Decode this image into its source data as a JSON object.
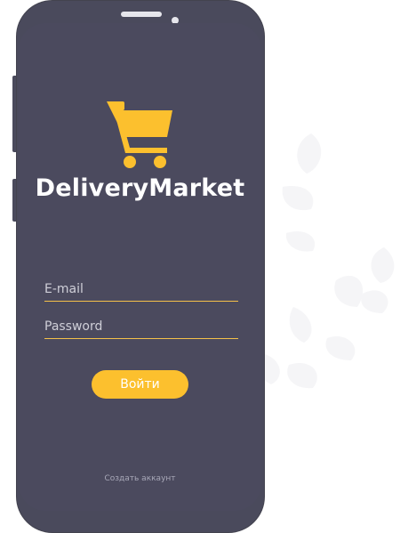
{
  "app": {
    "brand_name": "DeliveryMarket",
    "logo_icon": "shopping-cart-icon"
  },
  "login": {
    "email_placeholder": "E-mail",
    "password_placeholder": "Password",
    "email_value": "",
    "password_value": "",
    "submit_label": "Войти",
    "create_account_label": "Создать аккаунт"
  },
  "colors": {
    "screen_bg": "#4b4a5e",
    "accent": "#fcc02e",
    "text_primary": "#ffffff",
    "text_muted": "#a8a8b8"
  }
}
